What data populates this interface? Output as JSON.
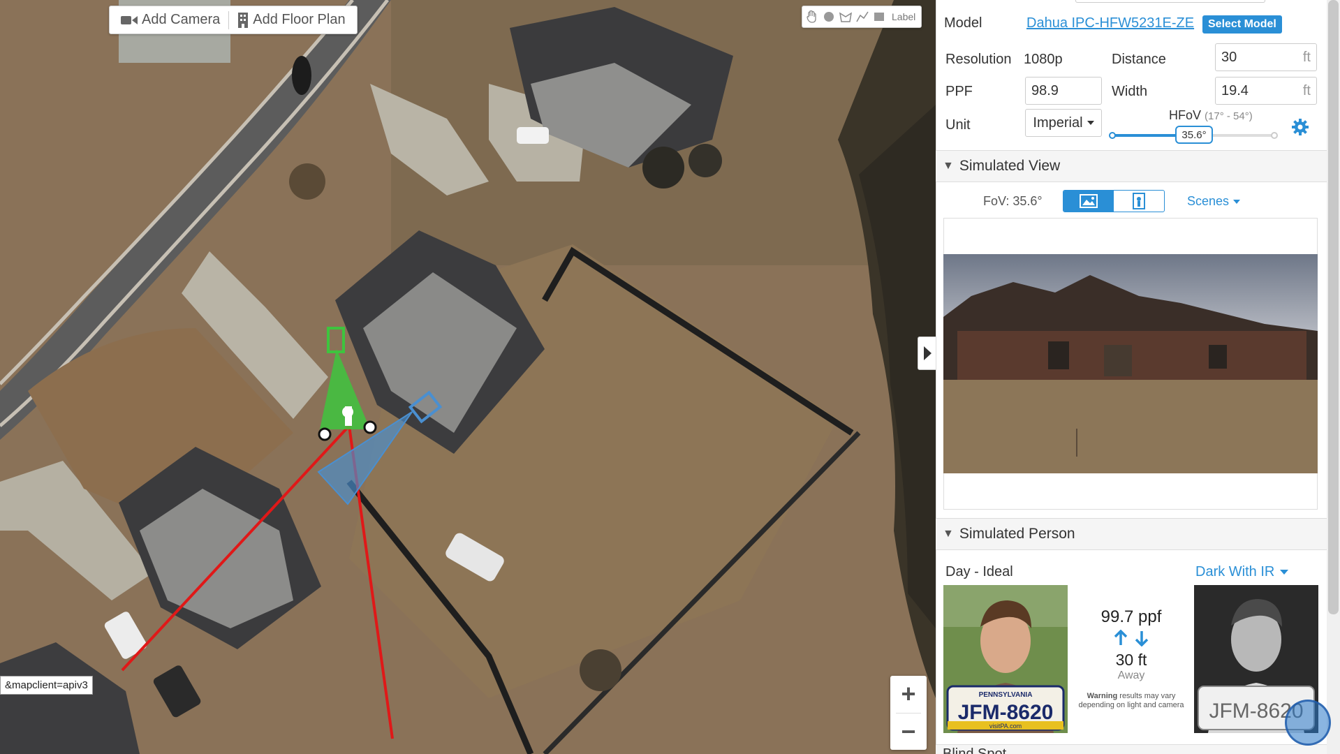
{
  "toolbar": {
    "add_camera": "Add Camera",
    "add_floor_plan": "Add Floor Plan",
    "draw_label": "Label"
  },
  "map": {
    "url_tip": "&mapclient=apiv3",
    "zoom_in": "+",
    "zoom_out": "−"
  },
  "camera": {
    "model_label": "Model",
    "model_value": "Dahua IPC-HFW5231E-ZE",
    "select_model": "Select Model",
    "resolution_label": "Resolution",
    "resolution_value": "1080p",
    "distance_label": "Distance",
    "distance_value": "30",
    "distance_unit": "ft",
    "ppf_label": "PPF",
    "ppf_value": "98.9",
    "width_label": "Width",
    "width_value": "19.4",
    "width_unit": "ft",
    "unit_label": "Unit",
    "unit_value": "Imperial",
    "hfov_label": "HFoV",
    "hfov_range": "(17° - 54°)",
    "hfov_value": "35.6°",
    "hfov_min": 17,
    "hfov_max": 54,
    "hfov_current": 35.6
  },
  "simulated_view": {
    "title": "Simulated View",
    "fov_label": "FoV:",
    "fov_value": "35.6°",
    "scenes": "Scenes"
  },
  "simulated_person": {
    "title": "Simulated Person",
    "day_label": "Day - Ideal",
    "night_option": "Dark With IR",
    "ppf": "99.7 ppf",
    "distance": "30 ft",
    "away": "Away",
    "warning_bold": "Warning",
    "warning_text": "results may vary depending on light and camera",
    "plate_day": "JFM-8620",
    "plate_state": "PENNSYLVANIA",
    "plate_site": "visitPA.com",
    "plate_night": "JFM-8620"
  },
  "next_section": {
    "title": "Blind Spot"
  },
  "colors": {
    "accent": "#2a8fd6",
    "fov_red": "#e01818",
    "camera_green": "#3ec43e",
    "camera_blue": "#4a8fd0"
  }
}
